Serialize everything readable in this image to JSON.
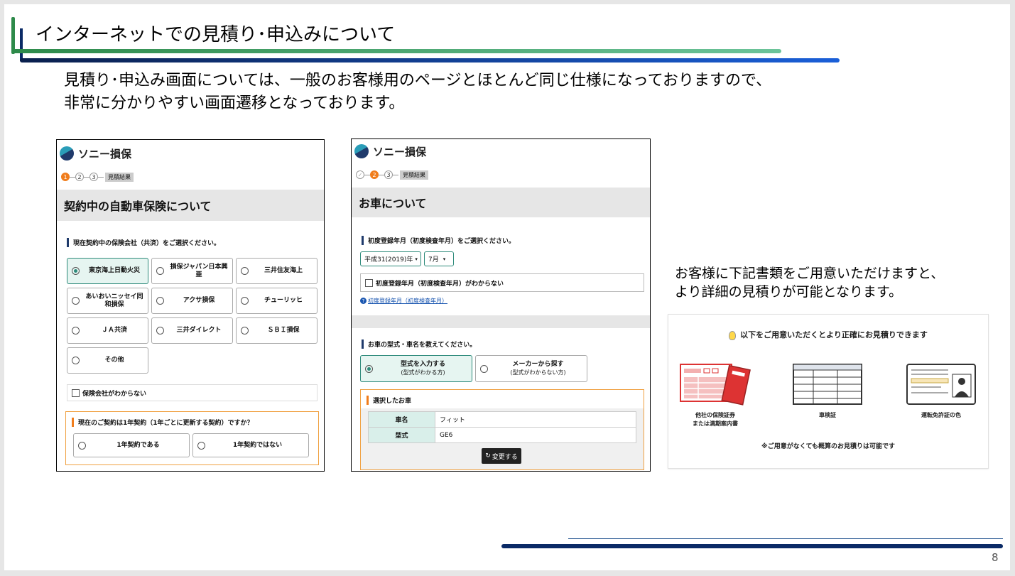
{
  "slide": {
    "title": "インターネットでの見積り･申込みについて",
    "intro_line1": "見積り･申込み画面については、一般のお客様用のページとほとんど同じ仕様になっておりますので、",
    "intro_line2": "非常に分かりやすい画面遷移となっております。",
    "page_number": "8",
    "colors": {
      "accent_green": "#2d8a4a",
      "accent_navy": "#0a2a66",
      "accent_blue": "#1a5fd8",
      "highlight_orange": "#f07d1c",
      "selected_teal": "#2d8a7a"
    }
  },
  "panel1": {
    "brand": "ソニー損保",
    "steps": [
      "1",
      "2",
      "3"
    ],
    "step_result": "見積結果",
    "heading": "契約中の自動車保険について",
    "question1": "現在契約中の保険会社（共済）をご選択ください。",
    "options": [
      {
        "label": "東京海上日動火災",
        "selected": true
      },
      {
        "label": "損保ジャパン日本興亜",
        "selected": false
      },
      {
        "label": "三井住友海上",
        "selected": false
      },
      {
        "label": "あいおいニッセイ同和損保",
        "selected": false
      },
      {
        "label": "アクサ損保",
        "selected": false
      },
      {
        "label": "チューリッヒ",
        "selected": false
      },
      {
        "label": "ＪＡ共済",
        "selected": false
      },
      {
        "label": "三井ダイレクト",
        "selected": false
      },
      {
        "label": "ＳＢＩ損保",
        "selected": false
      },
      {
        "label": "その他",
        "selected": false
      }
    ],
    "unknown_checkbox": "保険会社がわからない",
    "question2": "現在のご契約は1年契約（1年ごとに更新する契約）ですか？",
    "yes_label": "1年契約である",
    "no_label": "1年契約ではない"
  },
  "panel2": {
    "brand": "ソニー損保",
    "steps": [
      "✓",
      "2",
      "3"
    ],
    "step_result": "見積結果",
    "heading": "お車について",
    "question1": "初度登録年月（初度検査年月）をご選択ください。",
    "year_select": "平成31(2019)年",
    "month_select": "7月",
    "unknown_checkbox": "初度登録年月（初度検査年月）がわからない",
    "help_link": "初度登録年月（初度検査年月）",
    "question2": "お車の型式・車名を教えてください。",
    "tab1_label": "型式を入力する",
    "tab1_sub": "(型式がわかる方)",
    "tab2_label": "メーカーから探す",
    "tab2_sub": "(型式がわからない方)",
    "selected_car_title": "選択したお車",
    "rows": [
      {
        "key": "車名",
        "value": "フィット"
      },
      {
        "key": "型式",
        "value": "GE6"
      }
    ],
    "change_button": "変更する"
  },
  "right": {
    "text_line1": "お客様に下記書類をご用意いただけますと、",
    "text_line2": "より詳細の見積りが可能となります。",
    "card_heading": "以下をご用意いただくとより正確にお見積りできます",
    "doc1_line1": "他社の保険証券",
    "doc1_line2": "または満期案内書",
    "doc2": "車検証",
    "doc3": "運転免許証の色",
    "note": "※ご用意がなくても概算のお見積りは可能です"
  }
}
